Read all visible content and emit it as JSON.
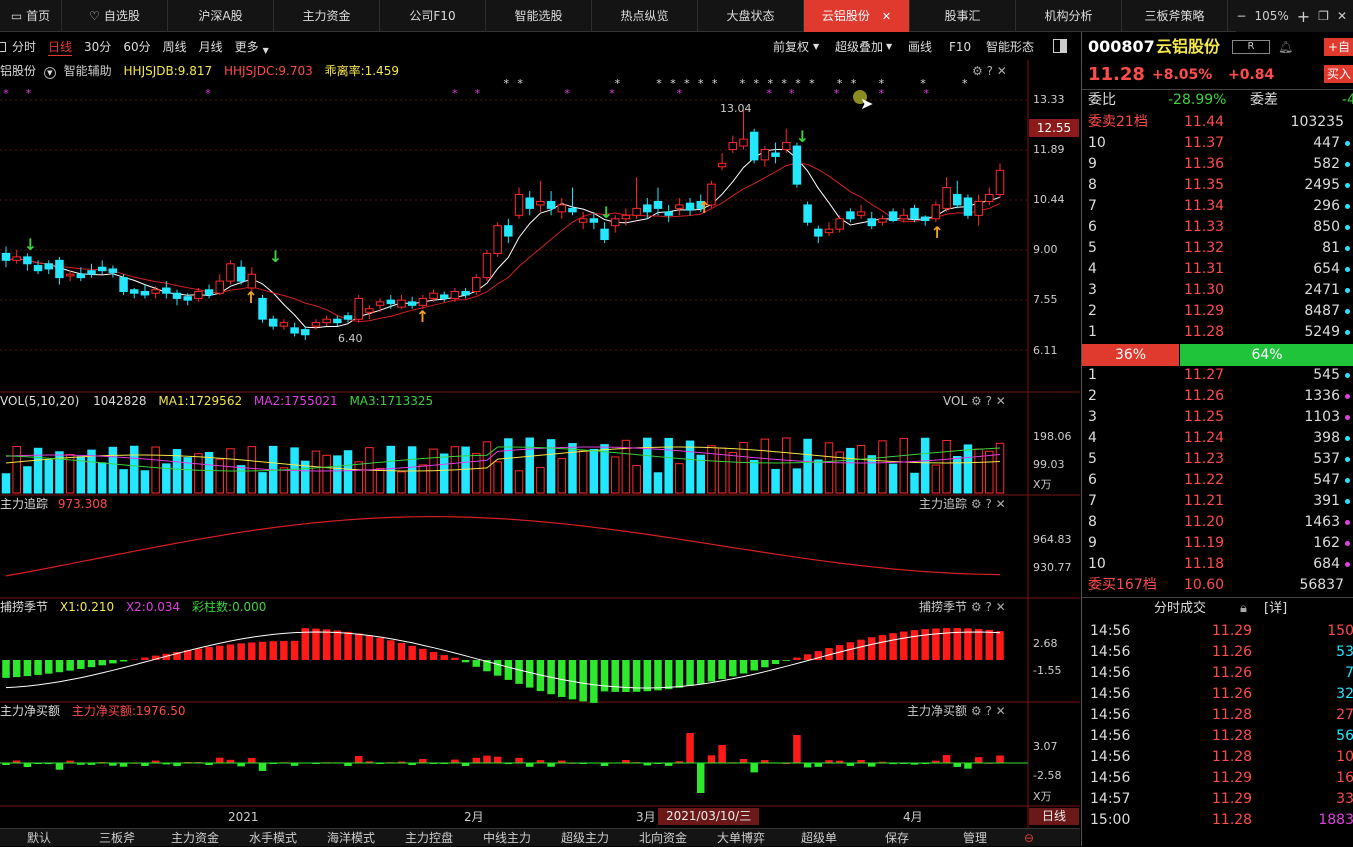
{
  "top_tabs": [
    {
      "label": "首页",
      "icon": "window-icon"
    },
    {
      "label": "自选股",
      "icon": "heart-icon"
    },
    {
      "label": "沪深A股"
    },
    {
      "label": "主力资金"
    },
    {
      "label": "公司F10"
    },
    {
      "label": "智能选股"
    },
    {
      "label": "热点纵览"
    },
    {
      "label": "大盘状态"
    },
    {
      "label": "云铝股份",
      "active": true
    },
    {
      "label": "股事汇"
    },
    {
      "label": "机构分析"
    },
    {
      "label": "三板斧策略"
    }
  ],
  "zoom": "105%",
  "toolbar": {
    "periods": [
      "分时",
      "日线",
      "30分",
      "60分",
      "周线",
      "月线",
      "更多"
    ],
    "active_period": "日线",
    "right": [
      "前复权",
      "超级叠加",
      "画线",
      "F10",
      "智能形态"
    ]
  },
  "main_legend": {
    "name": "铝股份",
    "aux": "智能辅助",
    "hhjsjdb": "HHJSJDB:9.817",
    "hhjsjdc": "HHJSJDC:9.703",
    "ratio": "乖离率:1.459"
  },
  "kline": {
    "price_axis": [
      "13.33",
      "11.89",
      "10.44",
      "9.00",
      "7.55",
      "6.11"
    ],
    "current_price_tag": "12.55",
    "high_label": "13.04",
    "low_label": "6.40",
    "candles": [
      {
        "o": 8.9,
        "c": 8.7,
        "h": 9.1,
        "l": 8.5
      },
      {
        "o": 8.7,
        "c": 8.8,
        "h": 9.0,
        "l": 8.6
      },
      {
        "o": 8.8,
        "c": 8.6,
        "h": 8.9,
        "l": 8.4
      },
      {
        "o": 8.55,
        "c": 8.4,
        "h": 8.7,
        "l": 8.3
      },
      {
        "o": 8.6,
        "c": 8.45,
        "h": 8.7,
        "l": 8.3
      },
      {
        "o": 8.7,
        "c": 8.2,
        "h": 8.8,
        "l": 8.0
      },
      {
        "o": 8.25,
        "c": 8.3,
        "h": 8.4,
        "l": 8.1
      },
      {
        "o": 8.3,
        "c": 8.2,
        "h": 8.5,
        "l": 8.1
      },
      {
        "o": 8.4,
        "c": 8.3,
        "h": 8.6,
        "l": 8.2
      },
      {
        "o": 8.5,
        "c": 8.4,
        "h": 8.7,
        "l": 8.3
      },
      {
        "o": 8.45,
        "c": 8.35,
        "h": 8.55,
        "l": 8.2
      },
      {
        "o": 8.2,
        "c": 7.8,
        "h": 8.3,
        "l": 7.7
      },
      {
        "o": 7.85,
        "c": 7.75,
        "h": 7.9,
        "l": 7.6
      },
      {
        "o": 7.8,
        "c": 7.7,
        "h": 8.0,
        "l": 7.6
      },
      {
        "o": 7.75,
        "c": 7.85,
        "h": 7.95,
        "l": 7.6
      },
      {
        "o": 7.9,
        "c": 7.75,
        "h": 8.1,
        "l": 7.6
      },
      {
        "o": 7.75,
        "c": 7.6,
        "h": 7.85,
        "l": 7.4
      },
      {
        "o": 7.65,
        "c": 7.55,
        "h": 7.75,
        "l": 7.4
      },
      {
        "o": 7.6,
        "c": 7.8,
        "h": 7.9,
        "l": 7.5
      },
      {
        "o": 7.85,
        "c": 7.7,
        "h": 8.0,
        "l": 7.6
      },
      {
        "o": 7.75,
        "c": 8.1,
        "h": 8.3,
        "l": 7.7
      },
      {
        "o": 8.1,
        "c": 8.6,
        "h": 8.7,
        "l": 8.0
      },
      {
        "o": 8.5,
        "c": 8.1,
        "h": 8.7,
        "l": 8.0
      },
      {
        "o": 7.9,
        "c": 8.3,
        "h": 8.5,
        "l": 7.8
      },
      {
        "o": 7.6,
        "c": 7.0,
        "h": 7.7,
        "l": 6.9
      },
      {
        "o": 7.0,
        "c": 6.8,
        "h": 7.1,
        "l": 6.7
      },
      {
        "o": 6.8,
        "c": 6.9,
        "h": 7.0,
        "l": 6.7
      },
      {
        "o": 6.75,
        "c": 6.6,
        "h": 6.9,
        "l": 6.5
      },
      {
        "o": 6.7,
        "c": 6.55,
        "h": 6.8,
        "l": 6.4
      },
      {
        "o": 6.8,
        "c": 6.9,
        "h": 7.0,
        "l": 6.7
      },
      {
        "o": 6.9,
        "c": 7.0,
        "h": 7.1,
        "l": 6.8
      },
      {
        "o": 7.0,
        "c": 6.9,
        "h": 7.1,
        "l": 6.8
      },
      {
        "o": 7.1,
        "c": 7.0,
        "h": 7.2,
        "l": 6.9
      },
      {
        "o": 7.0,
        "c": 7.6,
        "h": 7.7,
        "l": 6.9
      },
      {
        "o": 7.2,
        "c": 7.3,
        "h": 7.4,
        "l": 7.0
      },
      {
        "o": 7.4,
        "c": 7.5,
        "h": 7.6,
        "l": 7.2
      },
      {
        "o": 7.55,
        "c": 7.45,
        "h": 7.7,
        "l": 7.3
      },
      {
        "o": 7.35,
        "c": 7.55,
        "h": 7.7,
        "l": 7.3
      },
      {
        "o": 7.5,
        "c": 7.4,
        "h": 7.65,
        "l": 7.3
      },
      {
        "o": 7.4,
        "c": 7.6,
        "h": 7.7,
        "l": 7.3
      },
      {
        "o": 7.6,
        "c": 7.75,
        "h": 7.85,
        "l": 7.5
      },
      {
        "o": 7.7,
        "c": 7.6,
        "h": 7.8,
        "l": 7.5
      },
      {
        "o": 7.6,
        "c": 7.8,
        "h": 7.9,
        "l": 7.5
      },
      {
        "o": 7.8,
        "c": 7.7,
        "h": 7.9,
        "l": 7.6
      },
      {
        "o": 7.8,
        "c": 8.2,
        "h": 8.3,
        "l": 7.7
      },
      {
        "o": 8.2,
        "c": 8.9,
        "h": 9.0,
        "l": 8.1
      },
      {
        "o": 8.9,
        "c": 9.7,
        "h": 9.8,
        "l": 8.8
      },
      {
        "o": 9.7,
        "c": 9.4,
        "h": 9.9,
        "l": 9.2
      },
      {
        "o": 10.0,
        "c": 10.6,
        "h": 10.8,
        "l": 9.9
      },
      {
        "o": 10.5,
        "c": 10.2,
        "h": 10.7,
        "l": 10.0
      },
      {
        "o": 10.3,
        "c": 10.4,
        "h": 11.0,
        "l": 10.1
      },
      {
        "o": 10.4,
        "c": 10.2,
        "h": 10.7,
        "l": 10.0
      },
      {
        "o": 10.1,
        "c": 10.3,
        "h": 10.5,
        "l": 9.9
      },
      {
        "o": 10.2,
        "c": 10.1,
        "h": 10.8,
        "l": 10.0
      },
      {
        "o": 9.8,
        "c": 9.9,
        "h": 10.1,
        "l": 9.6
      },
      {
        "o": 9.9,
        "c": 9.8,
        "h": 10.1,
        "l": 9.6
      },
      {
        "o": 9.6,
        "c": 9.3,
        "h": 9.8,
        "l": 9.2
      },
      {
        "o": 9.7,
        "c": 9.9,
        "h": 10.0,
        "l": 9.5
      },
      {
        "o": 9.9,
        "c": 10.0,
        "h": 10.2,
        "l": 9.7
      },
      {
        "o": 10.0,
        "c": 10.2,
        "h": 11.1,
        "l": 9.9
      },
      {
        "o": 10.3,
        "c": 10.1,
        "h": 10.5,
        "l": 9.9
      },
      {
        "o": 10.4,
        "c": 10.2,
        "h": 10.8,
        "l": 10.0
      },
      {
        "o": 10.1,
        "c": 10.0,
        "h": 10.3,
        "l": 9.8
      },
      {
        "o": 10.2,
        "c": 10.3,
        "h": 10.5,
        "l": 10.0
      },
      {
        "o": 10.35,
        "c": 10.15,
        "h": 10.5,
        "l": 10.0
      },
      {
        "o": 10.4,
        "c": 10.2,
        "h": 10.6,
        "l": 10.1
      },
      {
        "o": 10.3,
        "c": 10.9,
        "h": 11.0,
        "l": 10.2
      },
      {
        "o": 11.4,
        "c": 11.5,
        "h": 11.8,
        "l": 11.3
      },
      {
        "o": 11.9,
        "c": 12.1,
        "h": 12.3,
        "l": 11.8
      },
      {
        "o": 12.0,
        "c": 12.2,
        "h": 13.04,
        "l": 11.9
      },
      {
        "o": 12.4,
        "c": 11.6,
        "h": 12.5,
        "l": 11.5
      },
      {
        "o": 11.6,
        "c": 11.9,
        "h": 12.0,
        "l": 11.4
      },
      {
        "o": 11.8,
        "c": 11.7,
        "h": 12.1,
        "l": 11.5
      },
      {
        "o": 11.9,
        "c": 12.1,
        "h": 12.5,
        "l": 11.8
      },
      {
        "o": 12.0,
        "c": 10.9,
        "h": 12.1,
        "l": 10.8
      },
      {
        "o": 10.3,
        "c": 9.8,
        "h": 10.4,
        "l": 9.7
      },
      {
        "o": 9.6,
        "c": 9.4,
        "h": 9.7,
        "l": 9.2
      },
      {
        "o": 9.5,
        "c": 9.6,
        "h": 9.8,
        "l": 9.4
      },
      {
        "o": 9.6,
        "c": 9.9,
        "h": 10.0,
        "l": 9.5
      },
      {
        "o": 10.1,
        "c": 9.9,
        "h": 10.2,
        "l": 9.8
      },
      {
        "o": 10.0,
        "c": 10.1,
        "h": 10.3,
        "l": 9.9
      },
      {
        "o": 9.9,
        "c": 9.7,
        "h": 10.1,
        "l": 9.6
      },
      {
        "o": 9.8,
        "c": 9.9,
        "h": 10.0,
        "l": 9.7
      },
      {
        "o": 10.1,
        "c": 9.85,
        "h": 10.2,
        "l": 9.8
      },
      {
        "o": 9.9,
        "c": 10.0,
        "h": 10.2,
        "l": 9.8
      },
      {
        "o": 10.2,
        "c": 9.9,
        "h": 10.3,
        "l": 9.8
      },
      {
        "o": 9.95,
        "c": 9.85,
        "h": 10.0,
        "l": 9.7
      },
      {
        "o": 9.9,
        "c": 10.3,
        "h": 10.4,
        "l": 9.8
      },
      {
        "o": 10.2,
        "c": 10.8,
        "h": 11.1,
        "l": 10.1
      },
      {
        "o": 10.6,
        "c": 10.3,
        "h": 11.0,
        "l": 10.2
      },
      {
        "o": 10.5,
        "c": 10.0,
        "h": 10.6,
        "l": 9.9
      },
      {
        "o": 10.0,
        "c": 10.4,
        "h": 10.6,
        "l": 9.7
      },
      {
        "o": 10.4,
        "c": 10.6,
        "h": 10.8,
        "l": 10.3
      },
      {
        "o": 10.6,
        "c": 11.3,
        "h": 11.5,
        "l": 10.5
      }
    ]
  },
  "vol_legend": {
    "name": "VOL(5,10,20)",
    "value": "1042828",
    "ma1": "MA1:1729562",
    "ma2": "MA2:1755021",
    "ma3": "MA3:1713325",
    "title": "VOL"
  },
  "vol_axis": [
    "198.06",
    "99.03",
    "X万"
  ],
  "track_legend": {
    "name": "主力追踪",
    "value": "973.308",
    "title": "主力追踪"
  },
  "track_axis": [
    "964.83",
    "930.77"
  ],
  "season_legend": {
    "name": "捕捞季节",
    "x1": "X1:0.210",
    "x2": "X2:0.034",
    "bars": "彩柱数:0.000",
    "title": "捕捞季节"
  },
  "season_axis": [
    "2.68",
    "-1.55"
  ],
  "net_legend": {
    "name": "主力净买额",
    "value": "主力净买额:1976.50",
    "title": "主力净买额"
  },
  "net_axis": [
    "3.07",
    "-2.58",
    "X万"
  ],
  "x_axis": {
    "labels": [
      "2021",
      "2月",
      "3月",
      "4月"
    ],
    "cursor_date": "2021/03/10/三",
    "period_tag": "日线"
  },
  "bottom_tabs": [
    "默认",
    "三板斧",
    "主力资金",
    "水手模式",
    "海洋模式",
    "主力控盘",
    "中线主力",
    "超级主力",
    "北向资金",
    "大单博弈",
    "超级单",
    "保存",
    "管理"
  ],
  "stock": {
    "code": "000807",
    "name": "云铝股份",
    "badge": "R",
    "add_label": "+自",
    "buy_label": "买入",
    "price": "11.28",
    "change_pct": "+8.05%",
    "change": "+0.84"
  },
  "order_book": {
    "weibi_label": "委比",
    "weibi": "-28.99%",
    "weicha_label": "委差",
    "weicha": "-4",
    "sell_total_label": "委卖21档",
    "sell_total_price": "11.44",
    "sell_total_vol": "103235",
    "sells": [
      {
        "n": "10",
        "p": "11.37",
        "v": "447",
        "dot": "#25e6ff"
      },
      {
        "n": "9",
        "p": "11.36",
        "v": "582",
        "dot": "#25e6ff"
      },
      {
        "n": "8",
        "p": "11.35",
        "v": "2495",
        "dot": "#25e6ff"
      },
      {
        "n": "7",
        "p": "11.34",
        "v": "296",
        "dot": "#25e6ff"
      },
      {
        "n": "6",
        "p": "11.33",
        "v": "850",
        "dot": "#25e6ff"
      },
      {
        "n": "5",
        "p": "11.32",
        "v": "81",
        "dot": "#25e6ff"
      },
      {
        "n": "4",
        "p": "11.31",
        "v": "654",
        "dot": "#25e6ff"
      },
      {
        "n": "3",
        "p": "11.30",
        "v": "2471",
        "dot": "#25e6ff"
      },
      {
        "n": "2",
        "p": "11.29",
        "v": "8487",
        "dot": "#25e6ff"
      },
      {
        "n": "1",
        "p": "11.28",
        "v": "5249",
        "dot": "#25e6ff"
      }
    ],
    "ratio_left": "36%",
    "ratio_right": "64%",
    "ratio_left_fraction": 0.36,
    "buys": [
      {
        "n": "1",
        "p": "11.27",
        "v": "545",
        "dot": "#25e6ff"
      },
      {
        "n": "2",
        "p": "11.26",
        "v": "1336",
        "dot": "#e040e0"
      },
      {
        "n": "3",
        "p": "11.25",
        "v": "1103",
        "dot": "#e040e0"
      },
      {
        "n": "4",
        "p": "11.24",
        "v": "398",
        "dot": "#25e6ff"
      },
      {
        "n": "5",
        "p": "11.23",
        "v": "537",
        "dot": "#25e6ff"
      },
      {
        "n": "6",
        "p": "11.22",
        "v": "547",
        "dot": "#25e6ff"
      },
      {
        "n": "7",
        "p": "11.21",
        "v": "391",
        "dot": "#25e6ff"
      },
      {
        "n": "8",
        "p": "11.20",
        "v": "1463",
        "dot": "#e040e0"
      },
      {
        "n": "9",
        "p": "11.19",
        "v": "162",
        "dot": "#e040e0"
      },
      {
        "n": "10",
        "p": "11.18",
        "v": "684",
        "dot": "#e040e0"
      }
    ],
    "buy_total_label": "委买167档",
    "buy_total_price": "10.60",
    "buy_total_vol": "56837"
  },
  "trades": {
    "title": "分时成交",
    "detail": "[详]",
    "rows": [
      {
        "t": "14:56",
        "p": "11.29",
        "v": "150",
        "c": "#ff4b4b"
      },
      {
        "t": "14:56",
        "p": "11.26",
        "v": "53",
        "c": "#25e6ff"
      },
      {
        "t": "14:56",
        "p": "11.26",
        "v": "7",
        "c": "#25e6ff"
      },
      {
        "t": "14:56",
        "p": "11.26",
        "v": "32",
        "c": "#25e6ff"
      },
      {
        "t": "14:56",
        "p": "11.28",
        "v": "27",
        "c": "#ff4b4b"
      },
      {
        "t": "14:56",
        "p": "11.28",
        "v": "56",
        "c": "#25e6ff"
      },
      {
        "t": "14:56",
        "p": "11.28",
        "v": "10",
        "c": "#ff4b4b"
      },
      {
        "t": "14:56",
        "p": "11.29",
        "v": "16",
        "c": "#ff4b4b"
      },
      {
        "t": "14:57",
        "p": "11.29",
        "v": "33",
        "c": "#ff4b4b"
      },
      {
        "t": "15:00",
        "p": "11.28",
        "v": "1883",
        "c": "#e040e0"
      }
    ]
  },
  "colors": {
    "up": "#ff2a2a",
    "down": "#25e6ff",
    "accent": "#e03a2f",
    "ma_white": "#ffffff",
    "ma_red": "#d42020"
  }
}
